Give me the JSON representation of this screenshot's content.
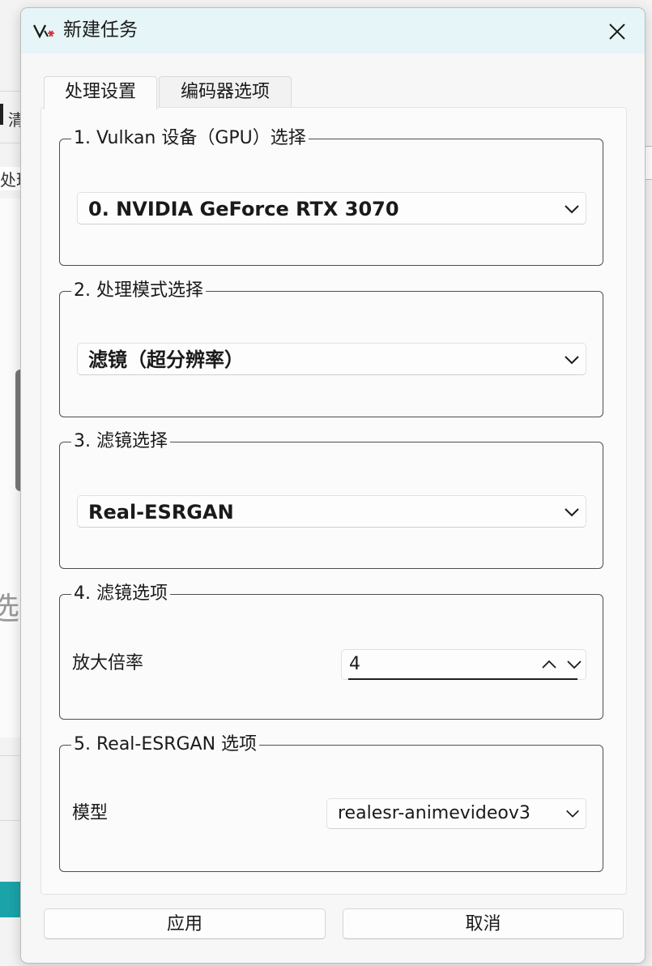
{
  "background": {
    "frag_1": "清",
    "frag_2": "处理",
    "frag_3": "选择"
  },
  "dialog": {
    "title": "新建任务",
    "tabs": [
      {
        "label": "处理设置",
        "active": true
      },
      {
        "label": "编码器选项",
        "active": false
      }
    ],
    "groups": {
      "gpu": {
        "title": "1. Vulkan 设备（GPU）选择",
        "selected": "0. NVIDIA GeForce RTX 3070"
      },
      "mode": {
        "title": "2. 处理模式选择",
        "selected": "滤镜（超分辨率）"
      },
      "filter": {
        "title": "3. 滤镜选择",
        "selected": "Real-ESRGAN"
      },
      "filter_options": {
        "title": "4. 滤镜选项",
        "scale_label": "放大倍率",
        "scale_value": "4"
      },
      "esrgan_options": {
        "title": "5. Real-ESRGAN 选项",
        "model_label": "模型",
        "model_value": "realesr-animevideov3"
      }
    },
    "buttons": {
      "apply": "应用",
      "cancel": "取消"
    }
  },
  "colors": {
    "titlebar": "#e6f5f7",
    "accent_teal": "#1aa3a8"
  }
}
